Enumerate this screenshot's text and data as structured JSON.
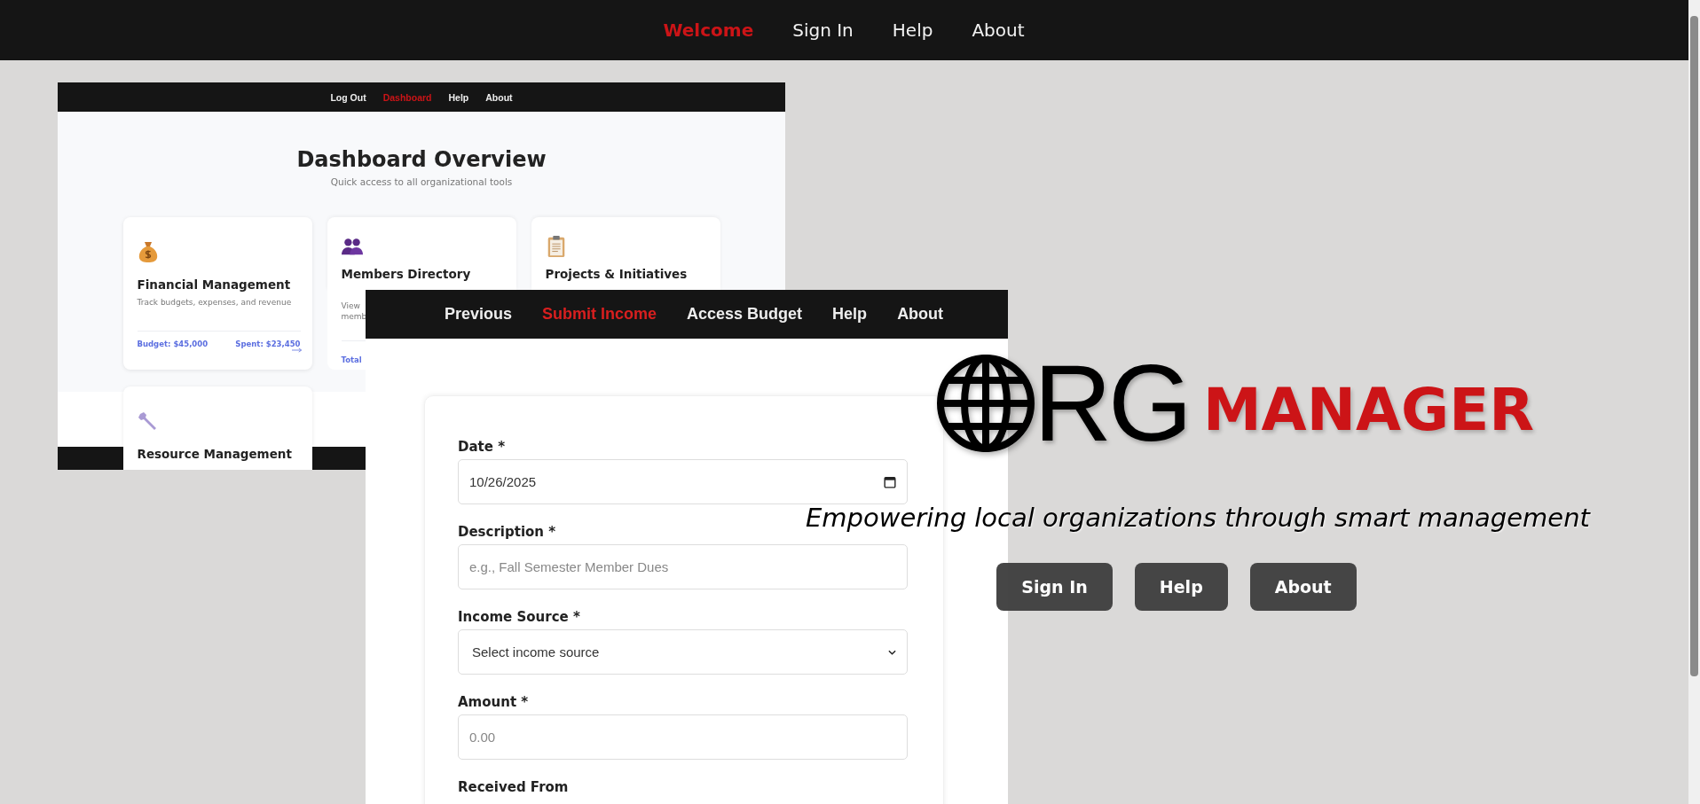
{
  "nav": [
    {
      "label": "Welcome",
      "selected": true
    },
    {
      "label": "Sign In",
      "selected": false
    },
    {
      "label": "Help",
      "selected": false
    },
    {
      "label": "About",
      "selected": false
    }
  ],
  "dashboard_screenshot": {
    "nav": [
      {
        "label": "Log Out",
        "selected": false
      },
      {
        "label": "Dashboard",
        "selected": true
      },
      {
        "label": "Help",
        "selected": false
      },
      {
        "label": "About",
        "selected": false
      }
    ],
    "title": "Dashboard Overview",
    "subtitle": "Quick access to all organizational tools",
    "cards": [
      {
        "title": "Financial Management",
        "description_lines": [
          "Track budgets, expenses, and revenue"
        ],
        "footer_left": "Budget: $45,000",
        "footer_right": "Spent: $23,450"
      },
      {
        "title": "Members Directory",
        "description_lines": [
          "View",
          "memb"
        ],
        "footer_left": "Total"
      },
      {
        "title": "Projects & Initiatives"
      },
      {
        "title": "Resource Management"
      }
    ]
  },
  "form_screenshot": {
    "nav": [
      {
        "label": "Previous",
        "selected": false
      },
      {
        "label": "Submit Income",
        "selected": true
      },
      {
        "label": "Access Budget",
        "selected": false
      },
      {
        "label": "Help",
        "selected": false
      },
      {
        "label": "About",
        "selected": false
      }
    ],
    "fields": [
      {
        "label": "Date *",
        "kind": "date",
        "value": "10/26/2025"
      },
      {
        "label": "Description *",
        "kind": "text",
        "placeholder": "e.g., Fall Semester Member Dues"
      },
      {
        "label": "Income Source *",
        "kind": "select",
        "value": "Select income source"
      },
      {
        "label": "Amount *",
        "kind": "text",
        "placeholder": "0.00"
      },
      {
        "label": "Received From",
        "kind": "none"
      }
    ]
  },
  "hero": {
    "logo_letters": "RG",
    "logo_word": "MANAGER",
    "tagline": "Empowering local organizations through smart management",
    "buttons": [
      "Sign In",
      "Help",
      "About"
    ]
  }
}
